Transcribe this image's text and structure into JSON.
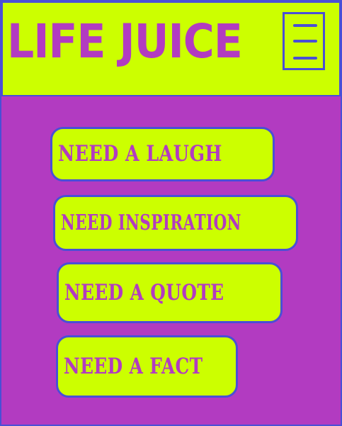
{
  "header": {
    "logo_text": "LIFE JUICE",
    "menu_icon": "hamburger-menu-icon"
  },
  "actions": [
    {
      "label": "NEED A LAUGH"
    },
    {
      "label": "NEED INSPIRATION"
    },
    {
      "label": "NEED A QUOTE"
    },
    {
      "label": "NEED A FACT"
    }
  ],
  "colors": {
    "background": "#b23bc1",
    "accent": "#ccff00",
    "border": "#4a4fd6"
  }
}
